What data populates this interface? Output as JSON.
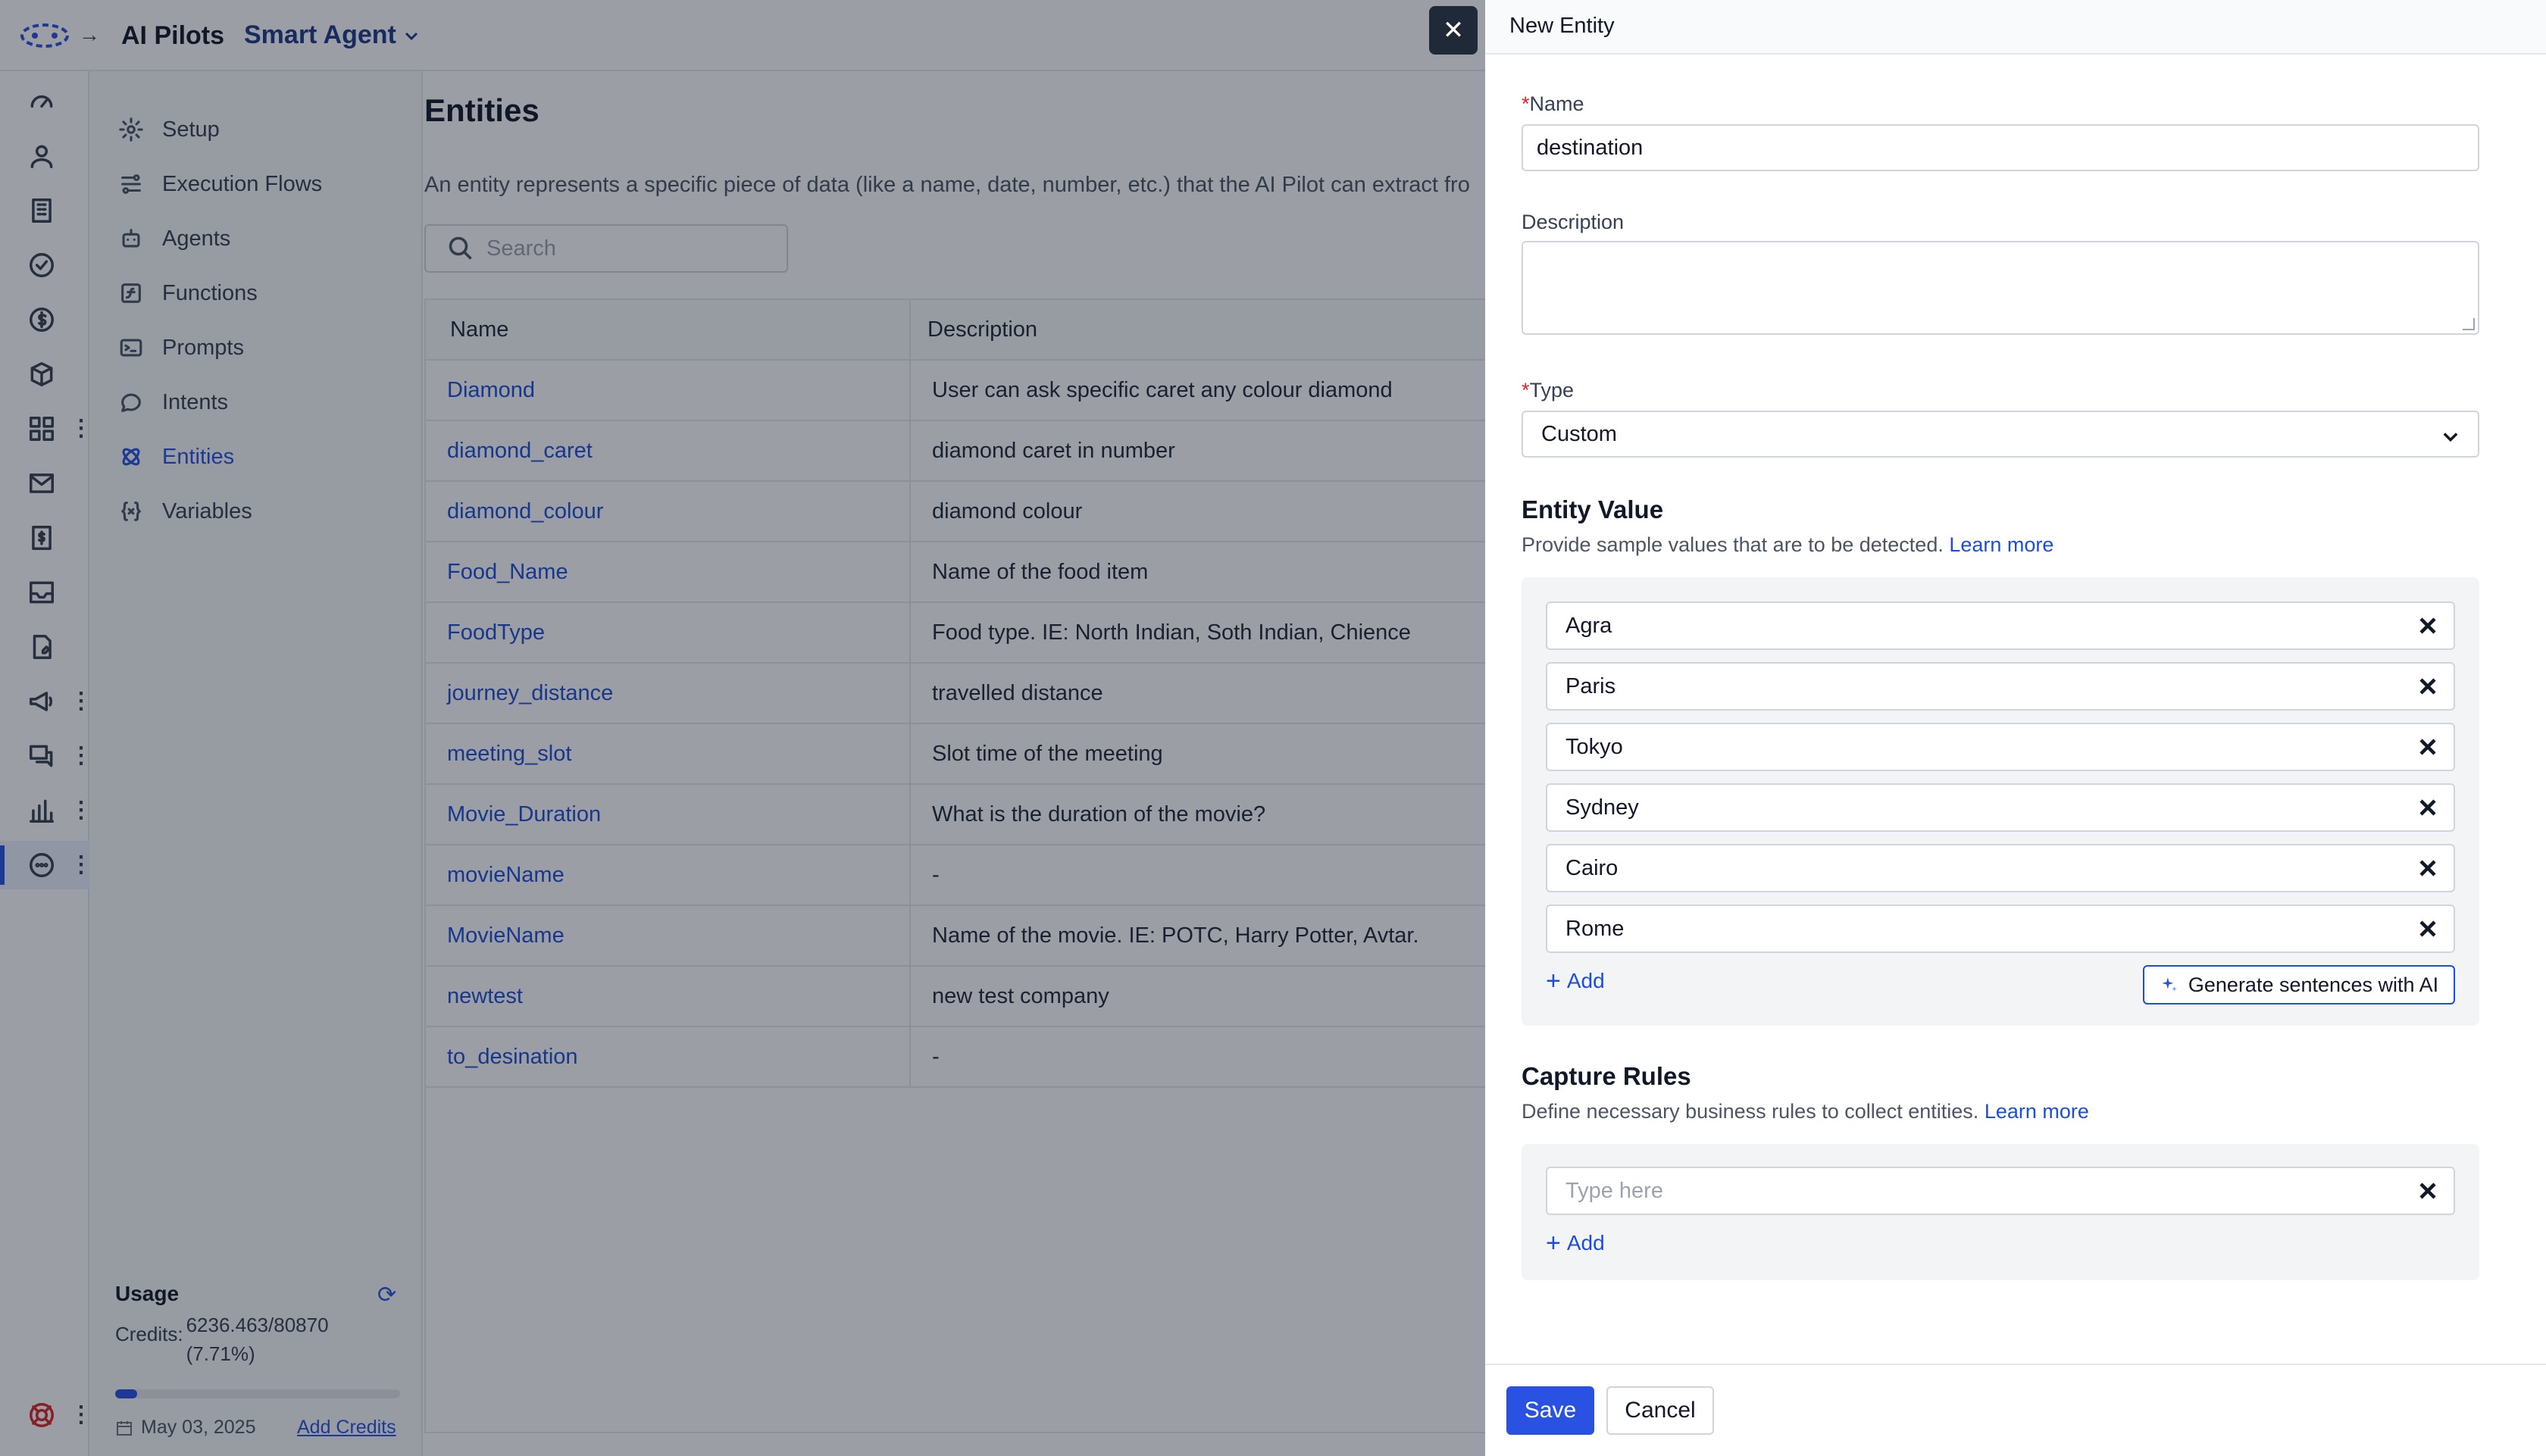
{
  "topbar": {
    "app_title": "AI Pilots",
    "agent_name": "Smart Agent"
  },
  "sidebar": {
    "items": [
      {
        "label": "Setup",
        "icon": "gear-icon"
      },
      {
        "label": "Execution Flows",
        "icon": "flow-icon"
      },
      {
        "label": "Agents",
        "icon": "robot-icon"
      },
      {
        "label": "Functions",
        "icon": "function-icon"
      },
      {
        "label": "Prompts",
        "icon": "terminal-icon"
      },
      {
        "label": "Intents",
        "icon": "chat-icon"
      },
      {
        "label": "Entities",
        "icon": "atom-icon",
        "active": true
      },
      {
        "label": "Variables",
        "icon": "braces-icon"
      }
    ],
    "usage": {
      "title": "Usage",
      "credits_label": "Credits:",
      "credits_value": "6236.463/80870 (7.71%)",
      "credits_percent": 7.71,
      "date": "May 03, 2025",
      "add_credits": "Add Credits"
    }
  },
  "main": {
    "title": "Entities",
    "description": "An entity represents a specific piece of data (like a name, date, number, etc.) that the AI Pilot can extract fro",
    "search_placeholder": "Search",
    "columns": [
      "Name",
      "Description"
    ],
    "rows": [
      {
        "name": "Diamond",
        "description": "User can ask specific caret any colour diamond"
      },
      {
        "name": "diamond_caret",
        "description": "diamond caret in number"
      },
      {
        "name": "diamond_colour",
        "description": "diamond colour"
      },
      {
        "name": "Food_Name",
        "description": "Name of the food item"
      },
      {
        "name": "FoodType",
        "description": "Food type. IE: North Indian, Soth Indian, Chience"
      },
      {
        "name": "journey_distance",
        "description": "travelled distance"
      },
      {
        "name": "meeting_slot",
        "description": "Slot time of the meeting"
      },
      {
        "name": "Movie_Duration",
        "description": "What is the duration of the movie?"
      },
      {
        "name": "movieName",
        "description": "-"
      },
      {
        "name": "MovieName",
        "description": "Name of the movie. IE: POTC, Harry Potter, Avtar."
      },
      {
        "name": "newtest",
        "description": "new test company"
      },
      {
        "name": "to_desination",
        "description": "-"
      }
    ]
  },
  "drawer": {
    "title": "New Entity",
    "name_label": "Name",
    "name_value": "destination",
    "required_mark": "*",
    "description_label": "Description",
    "description_value": "",
    "type_label": "Type",
    "type_value": "Custom",
    "entity_value": {
      "title": "Entity Value",
      "subtitle": "Provide sample values that are to be detected.",
      "learn_more": "Learn more",
      "values": [
        "Agra",
        "Paris",
        "Tokyo",
        "Sydney",
        "Cairo",
        "Rome"
      ],
      "add_label": "Add",
      "generate_label": "Generate sentences with AI"
    },
    "capture_rules": {
      "title": "Capture Rules",
      "subtitle": "Define necessary business rules to collect entities.",
      "learn_more": "Learn more",
      "placeholder": "Type here",
      "add_label": "Add"
    },
    "save_label": "Save",
    "cancel_label": "Cancel",
    "close_symbol": "✕"
  },
  "colors": {
    "accent": "#2952e3",
    "link": "#1d4ed8",
    "required": "#dc2626",
    "overlay": "rgba(17,24,39,0.42)"
  }
}
